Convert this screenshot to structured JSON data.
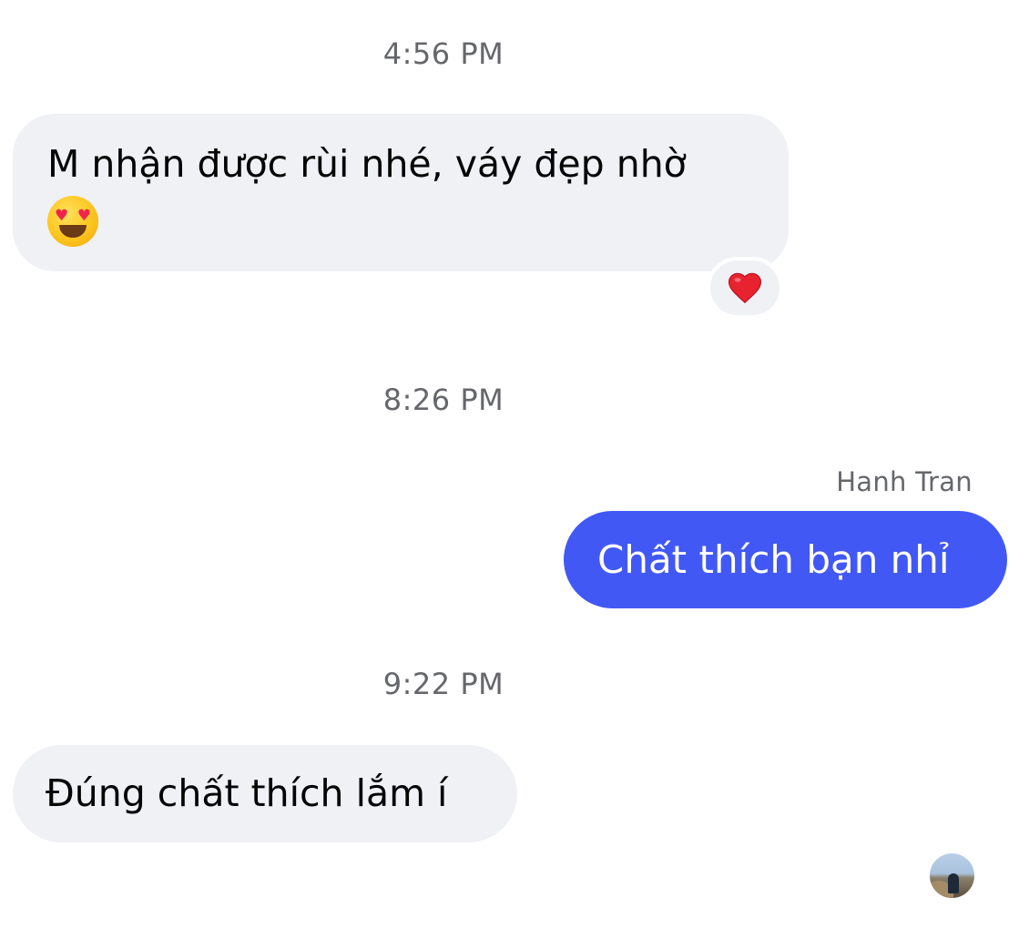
{
  "conversation": {
    "timestamps": [
      "4:56 PM",
      "8:26 PM",
      "9:22 PM"
    ],
    "messages": [
      {
        "direction": "incoming",
        "text_line1": "M nhận được rùi nhé, váy đẹp nhờ",
        "emoji": "heart-eyes-emoji",
        "reaction": "❤️"
      },
      {
        "direction": "outgoing",
        "sender": "Hanh Tran",
        "text": "Chất thích bạn nhỉ"
      },
      {
        "direction": "incoming",
        "text": "Đúng chất thích lắm í"
      }
    ],
    "read_receipt": "avatar"
  },
  "colors": {
    "incoming_bubble": "#f0f1f5",
    "outgoing_bubble": "#4258f5",
    "timestamp_text": "#65676b",
    "reaction_heart": "#e8222e"
  }
}
